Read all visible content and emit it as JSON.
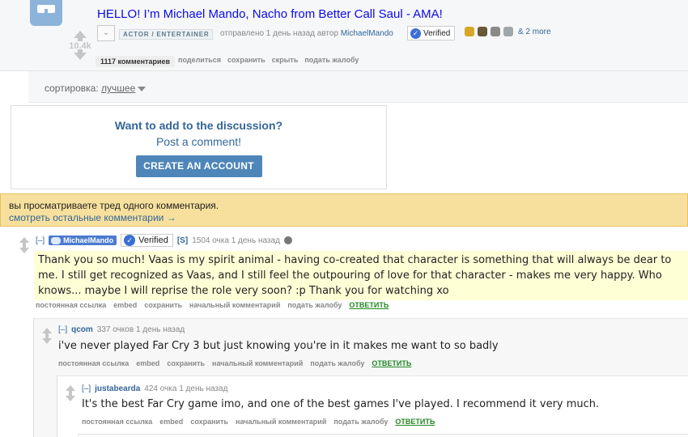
{
  "post": {
    "title": "HELLO! I’m Michael Mando, Nacho from Better Call Saul - AMA!",
    "score": "10.4k",
    "flair": "ACTOR / ENTERTAINER",
    "submitted_prefix": "отправлено 1 день назад автор",
    "author": "MichaelMando",
    "verified": "Verified",
    "more_awards": "& 2 more",
    "buttons": {
      "comments": "1117 комментариев",
      "share": "поделиться",
      "save": "сохранить",
      "hide": "скрыть",
      "report": "подать жалобу"
    }
  },
  "sort": {
    "label": "сортировка:",
    "value": "лучшее"
  },
  "discussion": {
    "title": "Want to add to the discussion?",
    "subtitle": "Post a comment!",
    "button": "CREATE AN ACCOUNT"
  },
  "thread_notice": {
    "text": "вы просматриваете тред одного комментария.",
    "link": "смотреть остальные комментарии →"
  },
  "comments": [
    {
      "toggle": "[–]",
      "author": "MichaelMando",
      "verified": "Verified",
      "submitter": "[S]",
      "meta": "1504 очка 1 день назад",
      "body": "Thank you so much! Vaas is my spirit animal - having co-created that character is something that will always be dear to me. I still get recognized as Vaas, and I still feel the outpouring of love for that character - makes me very happy. Who knows... maybe I will reprise the role very soon? :p Thank you for watching xo",
      "buttons": {
        "permalink": "постоянная ссылка",
        "embed": "embed",
        "save": "сохранить",
        "parent": "начальный комментарий",
        "report": "подать жалобу",
        "reply": "ОТВЕТИТЬ"
      }
    },
    {
      "toggle": "[–]",
      "author": "qcom",
      "meta": "337 очков 1 день назад",
      "body": "i've never played Far Cry 3 but just knowing you're in it makes me want to so badly",
      "buttons": {
        "permalink": "постоянная ссылка",
        "embed": "embed",
        "save": "сохранить",
        "parent": "начальный комментарий",
        "report": "подать жалобу",
        "reply": "ОТВЕТИТЬ"
      }
    },
    {
      "toggle": "[–]",
      "author": "justabearda",
      "meta": "424 очка 1 день назад",
      "body": "It's the best Far Cry game imo, and one of the best games I've played. I recommend it very much.",
      "buttons": {
        "permalink": "постоянная ссылка",
        "embed": "embed",
        "save": "сохранить",
        "parent": "начальный комментарий",
        "report": "подать жалобу",
        "reply": "ОТВЕТИТЬ"
      }
    }
  ],
  "colors": {
    "link": "#369",
    "title": "#0a0af0",
    "notice_bg": "#f7e09d",
    "button_bg": "#4f86b9",
    "reply": "#228822",
    "highlight": "#ffffd6"
  }
}
